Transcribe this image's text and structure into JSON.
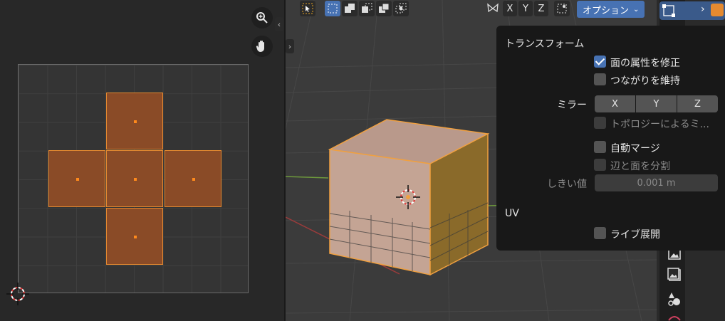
{
  "uv_editor": {
    "zoom_icon": "zoom-in-icon",
    "pan_icon": "hand-pan-icon"
  },
  "viewport_header": {
    "select_tool_icon": "cursor-select-icon",
    "select_mode_icons": [
      "box-select-new-icon",
      "select-extend-icon",
      "select-subtract-icon",
      "select-invert-icon",
      "select-intersect-icon"
    ],
    "mirror_axes": [
      "X",
      "Y",
      "Z"
    ],
    "options_label": "オプション",
    "options_chevron": "chevron-down-icon"
  },
  "options_popover": {
    "section_transform": "トランスフォーム",
    "correct_face_attributes": {
      "label": "面の属性を修正",
      "checked": true
    },
    "keep_connected": {
      "label": "つながりを維持",
      "checked": false
    },
    "mirror_label": "ミラー",
    "mirror_buttons": [
      "X",
      "Y",
      "Z"
    ],
    "topology_mirror": {
      "label": "トポロジーによるミ...",
      "checked": false,
      "disabled": true
    },
    "auto_merge": {
      "label": "自動マージ",
      "checked": false
    },
    "split_edges_faces": {
      "label": "辺と面を分割",
      "checked": false,
      "disabled": true
    },
    "threshold_label": "しきい値",
    "threshold_value": "0.001 m",
    "section_uv": "UV",
    "live_unwrap": {
      "label": "ライブ展開",
      "checked": false
    }
  },
  "colors": {
    "accent_blue": "#4772b3",
    "selection_orange": "#e58a30",
    "uv_face_fill": "#8a4b27"
  }
}
